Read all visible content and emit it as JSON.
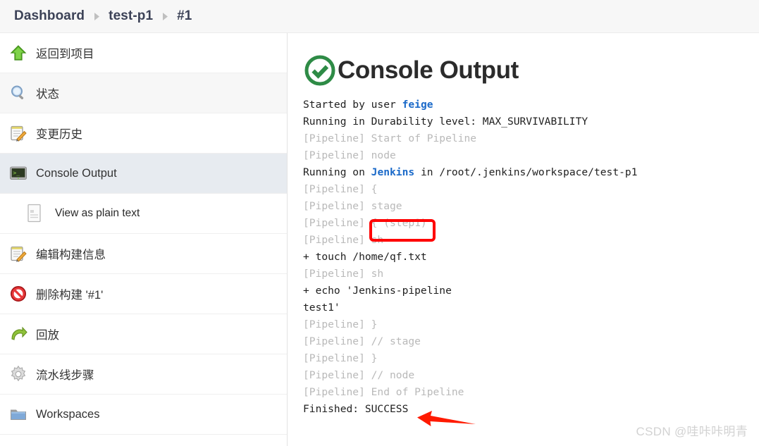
{
  "breadcrumb": {
    "items": [
      {
        "label": "Dashboard",
        "name": "breadcrumb-dashboard"
      },
      {
        "label": "test-p1",
        "name": "breadcrumb-test-p1"
      },
      {
        "label": "#1",
        "name": "breadcrumb-build-1"
      }
    ],
    "separator_icon": "chevron-right-icon"
  },
  "sidebar": {
    "items": [
      {
        "label": "返回到项目",
        "icon": "up-arrow-icon",
        "state": "normal"
      },
      {
        "label": "状态",
        "icon": "magnifier-icon",
        "state": "alt"
      },
      {
        "label": "变更历史",
        "icon": "notepad-pencil-icon",
        "state": "normal"
      },
      {
        "label": "Console Output",
        "icon": "terminal-icon",
        "state": "selected"
      },
      {
        "label": "View as plain text",
        "icon": "document-icon",
        "state": "sub"
      },
      {
        "label": "编辑构建信息",
        "icon": "notepad-pencil-icon",
        "state": "normal"
      },
      {
        "label": "删除构建 '#1'",
        "icon": "no-entry-icon",
        "state": "normal"
      },
      {
        "label": "回放",
        "icon": "redo-arrow-icon",
        "state": "normal"
      },
      {
        "label": "流水线步骤",
        "icon": "gear-icon",
        "state": "normal"
      },
      {
        "label": "Workspaces",
        "icon": "folder-icon",
        "state": "normal"
      }
    ]
  },
  "main": {
    "title": "Console Output",
    "status_icon": "success-check-circle-icon",
    "console_lines": [
      {
        "muted": false,
        "parts": [
          {
            "text": "Started by user "
          },
          {
            "text": "feige",
            "link": true
          }
        ]
      },
      {
        "muted": false,
        "parts": [
          {
            "text": "Running in Durability level: MAX_SURVIVABILITY"
          }
        ]
      },
      {
        "muted": true,
        "parts": [
          {
            "text": "[Pipeline] Start of Pipeline"
          }
        ]
      },
      {
        "muted": true,
        "parts": [
          {
            "text": "[Pipeline] node"
          }
        ]
      },
      {
        "muted": false,
        "parts": [
          {
            "text": "Running on "
          },
          {
            "text": "Jenkins",
            "link": true
          },
          {
            "text": " in /root/.jenkins/workspace/test-p1"
          }
        ]
      },
      {
        "muted": true,
        "parts": [
          {
            "text": "[Pipeline] {"
          }
        ]
      },
      {
        "muted": true,
        "parts": [
          {
            "text": "[Pipeline] stage"
          }
        ]
      },
      {
        "muted": true,
        "parts": [
          {
            "text": "[Pipeline] { (step1)"
          }
        ]
      },
      {
        "muted": true,
        "parts": [
          {
            "text": "[Pipeline] sh"
          }
        ]
      },
      {
        "muted": false,
        "parts": [
          {
            "text": "+ touch /home/qf.txt"
          }
        ]
      },
      {
        "muted": true,
        "parts": [
          {
            "text": "[Pipeline] sh"
          }
        ]
      },
      {
        "muted": false,
        "parts": [
          {
            "text": "+ echo 'Jenkins-pipeline"
          }
        ]
      },
      {
        "muted": false,
        "parts": [
          {
            "text": "test1'"
          }
        ]
      },
      {
        "muted": true,
        "parts": [
          {
            "text": "[Pipeline] }"
          }
        ]
      },
      {
        "muted": true,
        "parts": [
          {
            "text": "[Pipeline] // stage"
          }
        ]
      },
      {
        "muted": true,
        "parts": [
          {
            "text": "[Pipeline] }"
          }
        ]
      },
      {
        "muted": true,
        "parts": [
          {
            "text": "[Pipeline] // node"
          }
        ]
      },
      {
        "muted": true,
        "parts": [
          {
            "text": "[Pipeline] End of Pipeline"
          }
        ]
      },
      {
        "muted": false,
        "parts": [
          {
            "text": "Finished: SUCCESS"
          }
        ]
      }
    ]
  },
  "annotations": {
    "highlight_box_target": "{ (step1)",
    "arrow_target": "Finished: SUCCESS",
    "color": "#ff0000"
  },
  "watermark": {
    "text": "CSDN @哇咔咔明青"
  },
  "colors": {
    "header_bg": "#f7f7f7",
    "selected_row_bg": "#e7ebf0",
    "alt_row_bg": "#f7f7f7",
    "success_green": "#2e8b46",
    "link_blue": "#1b6ac9",
    "muted_gray": "#b9b9b9",
    "annotation_red": "#ff0000"
  }
}
